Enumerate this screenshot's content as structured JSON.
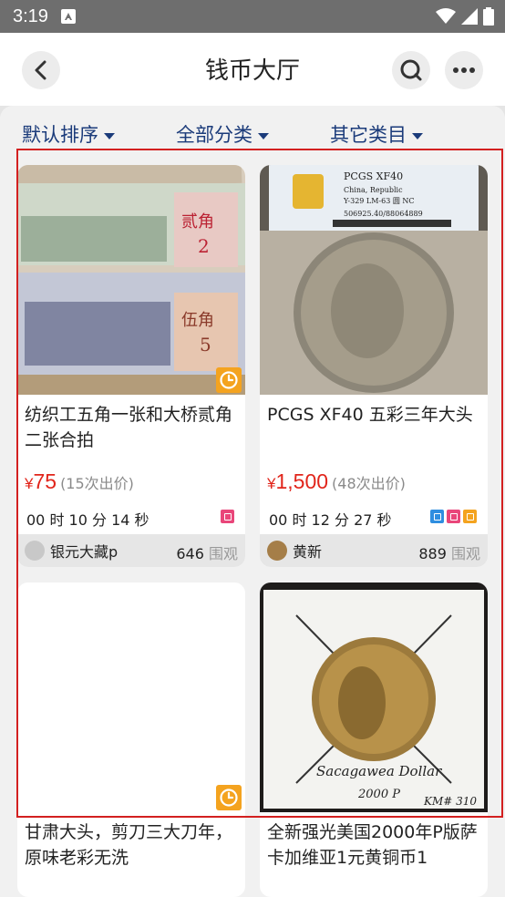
{
  "status_bar": {
    "time": "3:19"
  },
  "header": {
    "title": "钱币大厅"
  },
  "filters": [
    {
      "label": "默认排序"
    },
    {
      "label": "全部分类"
    },
    {
      "label": "其它类目"
    }
  ],
  "items": [
    {
      "title": "纺织工五角一张和大桥贰角二张合拍",
      "price_symbol": "¥",
      "price": "75",
      "bids": "(15次出价)",
      "countdown": "00 时 10 分 14 秒",
      "seller": "银元大藏p",
      "views": "646",
      "views_unit": "围观"
    },
    {
      "title": "PCGS XF40 五彩三年大头",
      "price_symbol": "¥",
      "price": "1,500",
      "bids": "(48次出价)",
      "countdown": "00 时 12 分 27 秒",
      "seller": "黄新",
      "views": "889",
      "views_unit": "围观"
    },
    {
      "title": "甘肃大头，剪刀三大刀年，原味老彩无洗"
    },
    {
      "title": "全新强光美国2000年P版萨卡加维亚1元黄铜币1"
    }
  ],
  "photo_text": {
    "pcgs_grade": "PCGS XF40",
    "pcgs_line2": "China, Republic",
    "pcgs_line3": "Y-329 LM-63 圆 NC",
    "pcgs_cert": "506925.40/88064889",
    "coin_caption1": "Sacagawea Dollar",
    "coin_caption2": "2000 P",
    "coin_caption3": "KM# 310"
  },
  "colors": {
    "accent": "#e1251b",
    "filter_text": "#1b3b7a",
    "clock_badge": "#f4a31f",
    "selection": "#d32020"
  }
}
